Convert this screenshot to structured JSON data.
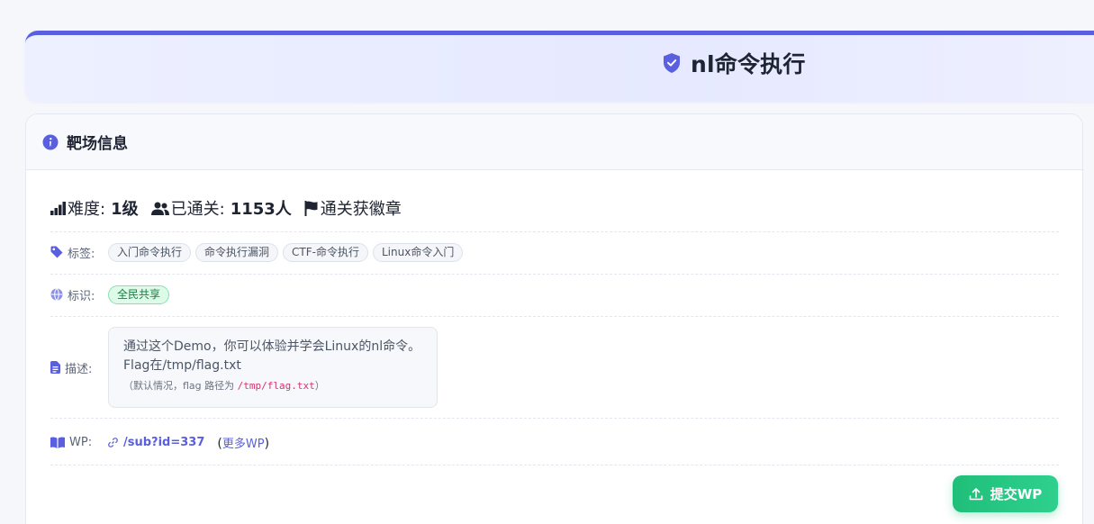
{
  "page": {
    "title": "nl命令执行"
  },
  "card": {
    "title": "靶场信息"
  },
  "stats": {
    "difficulty_label": "难度:",
    "difficulty_value": "1级",
    "solved_label": "已通关:",
    "solved_value": "1153人",
    "badge_label": "通关获徽章"
  },
  "tags": {
    "label": "标签:",
    "items": [
      "入门命令执行",
      "命令执行漏洞",
      "CTF-命令执行",
      "Linux命令入门"
    ]
  },
  "marks": {
    "label": "标识:",
    "items": [
      "全民共享"
    ]
  },
  "description": {
    "label": "描述:",
    "line1": "通过这个Demo，你可以体验并学会Linux的nl命令。",
    "line2": "Flag在/tmp/flag.txt",
    "note_prefix": "（默认情况，flag 路径为",
    "note_path": "/tmp/flag.txt",
    "note_suffix": "）"
  },
  "wp": {
    "label": "WP:",
    "link": "/sub?id=337",
    "more_open": "(",
    "more_link": "更多WP",
    "more_close": ")"
  },
  "actions": {
    "submit_label": "提交WP"
  },
  "colors": {
    "accent": "#5a5fe0",
    "success": "#1fbf7a",
    "code": "#d6336c"
  },
  "icons": [
    "shield-check-icon",
    "info-icon",
    "signal-bars-icon",
    "users-icon",
    "flag-icon",
    "tag-icon",
    "globe-icon",
    "document-icon",
    "book-icon",
    "link-icon",
    "upload-icon"
  ]
}
